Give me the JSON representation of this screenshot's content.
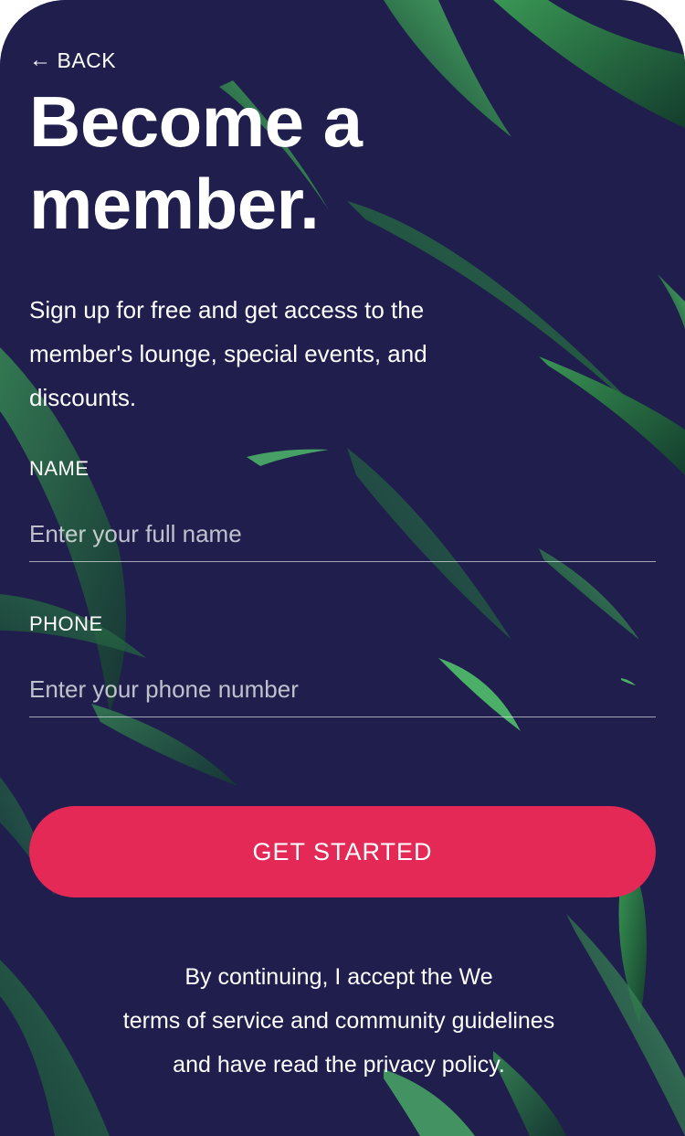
{
  "header": {
    "back_label": "BACK",
    "back_icon": "arrow-left-icon"
  },
  "hero": {
    "title_line1": "Become a",
    "title_line2": "member.",
    "subtitle": "Sign up for free and get access to the member's lounge, special events, and discounts."
  },
  "form": {
    "name": {
      "label": "NAME",
      "placeholder": "Enter your full name"
    },
    "phone": {
      "label": "PHONE",
      "placeholder": "Enter your phone number"
    },
    "submit_label": "GET STARTED"
  },
  "legal": {
    "line1": "By continuing, I accept the We",
    "terms_link": "terms of service and community guidelines",
    "line3_prefix": "and have read the ",
    "privacy_link": "privacy policy",
    "line3_suffix": "."
  },
  "colors": {
    "background": "#1f1e4c",
    "accent": "#e52957",
    "leaf_green": "#2f8a4a",
    "text": "#ffffff"
  }
}
